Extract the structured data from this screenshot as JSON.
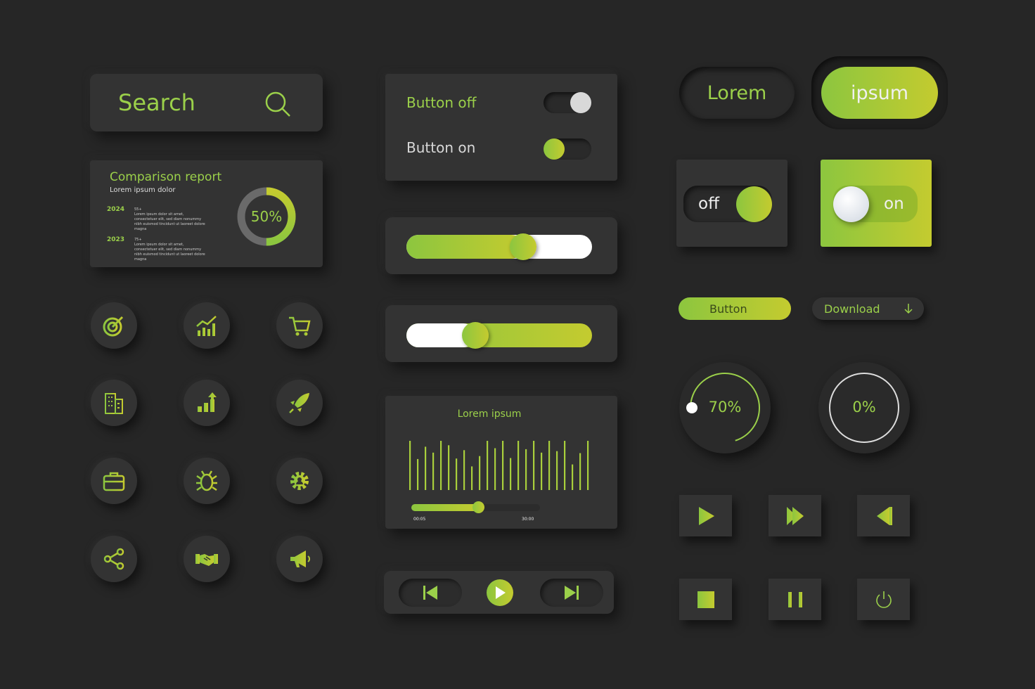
{
  "colors": {
    "background": "#262626",
    "panel": "#333333",
    "accent_start": "#8cc63f",
    "accent_end": "#c4cb2f",
    "text_light": "#e8e8e8"
  },
  "search": {
    "placeholder": "Search",
    "icon": "search-icon"
  },
  "report": {
    "title": "Comparison report",
    "subtitle": "Lorem ipsum dolor",
    "items": [
      {
        "year": "2024",
        "value": "55+",
        "description": "Lorem ipsum dolor sit amet, consectetuer elit, sed diam nonummy nibh euismod tincidunt ut laoreet dolore magna"
      },
      {
        "year": "2023",
        "value": "75+",
        "description": "Lorem ipsum dolor sit amet, consectetuer elit, sed diam nonummy nibh euismod tincidunt ut laoreet dolore magna"
      }
    ],
    "donut_percent": 50,
    "donut_label": "50%"
  },
  "icons": [
    "target-icon",
    "growth-chart-icon",
    "cart-icon",
    "building-icon",
    "bar-chart-up-icon",
    "rocket-icon",
    "briefcase-icon",
    "bug-icon",
    "gear-user-icon",
    "share-icon",
    "handshake-icon",
    "megaphone-icon"
  ],
  "toggles": [
    {
      "label": "Button off",
      "state": false
    },
    {
      "label": "Button on",
      "state": true
    }
  ],
  "sliders": [
    {
      "value_percent": 63,
      "fill": "left"
    },
    {
      "value_percent": 37,
      "fill": "right"
    }
  ],
  "audio": {
    "title": "Lorem ipsum",
    "current_time": "00:05",
    "total_time": "30:00",
    "progress_percent": 52,
    "levels": [
      100,
      63,
      88,
      76,
      100,
      91,
      64,
      81,
      48,
      69,
      100,
      85,
      100,
      65,
      100,
      83,
      100,
      76,
      100,
      79,
      100,
      52,
      75,
      100
    ]
  },
  "player": {
    "prev": "skip-back-icon",
    "play": "play-icon",
    "next": "skip-forward-icon"
  },
  "pills": {
    "lorem": "Lorem",
    "ipsum": "ipsum"
  },
  "switches": {
    "off_label": "off",
    "on_label": "on"
  },
  "buttons": {
    "button": "Button",
    "download": "Download"
  },
  "knobs": [
    {
      "label": "70%",
      "percent": 70
    },
    {
      "label": "0%",
      "percent": 0
    }
  ],
  "media": [
    "play-icon",
    "fast-forward-icon",
    "rewind-icon",
    "stop-icon",
    "pause-icon",
    "power-icon"
  ]
}
